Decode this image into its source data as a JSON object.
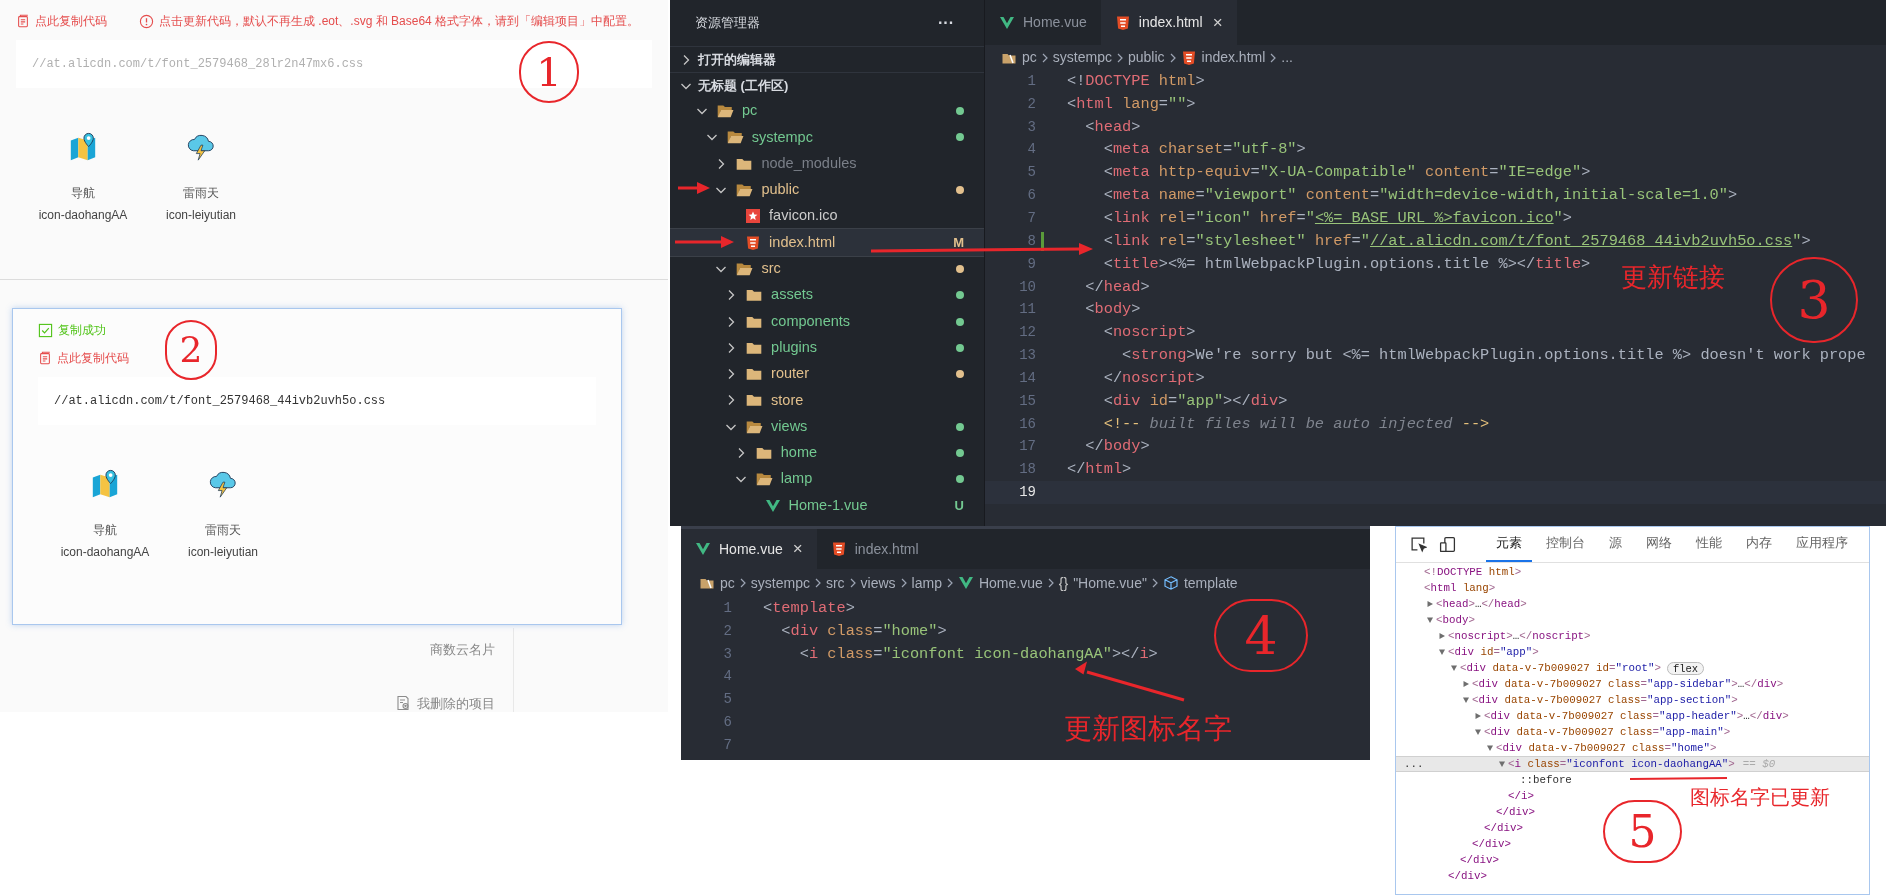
{
  "upload_panel": {
    "copy_link": "点此复制代码",
    "notice": "点击更新代码，默认不再生成 .eot、.svg 和 Base64 格式字体，请到「编辑项目」中配置。",
    "code": "//at.alicdn.com/t/font_2579468_28lr2n47mx6.css",
    "code_faded": true,
    "icons": [
      {
        "kind": "map",
        "label": "导航",
        "name": "icon-daohangAA"
      },
      {
        "kind": "storm",
        "label": "雷雨天",
        "name": "icon-leiyutian"
      }
    ],
    "annotation": "1"
  },
  "background_page": {
    "items": [
      {
        "kind": "text",
        "label": "商数云名片"
      },
      {
        "kind": "trash",
        "label": "我删除的项目"
      }
    ]
  },
  "copied_panel": {
    "success": "复制成功",
    "copy_link": "点此复制代码",
    "code": "//at.alicdn.com/t/font_2579468_44ivb2uvh5o.css",
    "code_faded": false,
    "icons": [
      {
        "kind": "map",
        "label": "导航",
        "name": "icon-daohangAA"
      },
      {
        "kind": "storm",
        "label": "雷雨天",
        "name": "icon-leiyutian"
      }
    ],
    "annotation": "2"
  },
  "code_editor": {
    "explorer": {
      "title": "资源管理器",
      "more": "···",
      "sections": [
        {
          "label": "打开的编辑器",
          "expanded": false
        },
        {
          "label": "无标题 (工作区)",
          "expanded": true,
          "children": [
            {
              "label": "pc",
              "kind": "folder",
              "expanded": true,
              "color": "#73c991",
              "dot": true,
              "selected": false,
              "children": [
                {
                  "label": "systempc",
                  "kind": "folder",
                  "expanded": true,
                  "color": "#73c991",
                  "dot": true,
                  "selected": false,
                  "children": [
                    {
                      "label": "node_modules",
                      "kind": "folder",
                      "expanded": false,
                      "color": "#7a7f88",
                      "dot": false,
                      "selected": false
                    },
                    {
                      "label": "public",
                      "kind": "folder",
                      "expanded": true,
                      "color": "#e2c08d",
                      "dot": true,
                      "selected": false,
                      "children": [
                        {
                          "label": "favicon.ico",
                          "kind": "favicon",
                          "color": "#cccccc",
                          "dot": false,
                          "selected": false
                        },
                        {
                          "label": "index.html",
                          "kind": "html",
                          "color": "#e2c08d",
                          "badge": "M",
                          "selected": true
                        }
                      ]
                    },
                    {
                      "label": "src",
                      "kind": "folder",
                      "expanded": true,
                      "color": "#e2c08d",
                      "dot": true,
                      "selected": false,
                      "children": [
                        {
                          "label": "assets",
                          "kind": "folder",
                          "expanded": false,
                          "color": "#73c991",
                          "dot": true,
                          "selected": false
                        },
                        {
                          "label": "components",
                          "kind": "folder",
                          "expanded": false,
                          "color": "#73c991",
                          "dot": true,
                          "selected": false
                        },
                        {
                          "label": "plugins",
                          "kind": "folder",
                          "expanded": false,
                          "color": "#73c991",
                          "dot": true,
                          "selected": false
                        },
                        {
                          "label": "router",
                          "kind": "folder",
                          "expanded": false,
                          "color": "#e2c08d",
                          "dot": true,
                          "selected": false
                        },
                        {
                          "label": "store",
                          "kind": "folder",
                          "expanded": false,
                          "color": "#e2c08d",
                          "dot": false,
                          "selected": false
                        },
                        {
                          "label": "views",
                          "kind": "folder",
                          "expanded": true,
                          "color": "#73c991",
                          "dot": true,
                          "selected": false,
                          "children": [
                            {
                              "label": "home",
                              "kind": "folder",
                              "expanded": false,
                              "color": "#73c991",
                              "dot": true,
                              "selected": false
                            },
                            {
                              "label": "lamp",
                              "kind": "folder",
                              "expanded": true,
                              "color": "#73c991",
                              "dot": true,
                              "selected": false,
                              "children": [
                                {
                                  "label": "Home-1.vue",
                                  "kind": "vue",
                                  "color": "#73c991",
                                  "badge": "U",
                                  "selected": false
                                }
                              ]
                            }
                          ]
                        }
                      ]
                    }
                  ]
                }
              ]
            }
          ]
        }
      ]
    },
    "tabs": [
      {
        "label": "Home.vue",
        "kind": "vue",
        "selected": false
      },
      {
        "label": "index.html",
        "kind": "html",
        "selected": true,
        "close": "×"
      }
    ],
    "breadcrumb": [
      {
        "label": "pc",
        "kind": "folder"
      },
      {
        "label": "systempc",
        "kind": "text"
      },
      {
        "label": "public",
        "kind": "text"
      },
      {
        "label": "index.html",
        "kind": "html"
      },
      {
        "label": "...",
        "kind": "text"
      }
    ],
    "lines": [
      {
        "n": "1",
        "text": "<!DOCTYPE html>",
        "changed": false,
        "current": false
      },
      {
        "n": "2",
        "text": "<html lang=\"\">",
        "changed": false,
        "current": false
      },
      {
        "n": "3",
        "text": "  <head>",
        "changed": false,
        "current": false
      },
      {
        "n": "4",
        "text": "    <meta charset=\"utf-8\">",
        "changed": false,
        "current": false
      },
      {
        "n": "5",
        "text": "    <meta http-equiv=\"X-UA-Compatible\" content=\"IE=edge\">",
        "changed": false,
        "current": false
      },
      {
        "n": "6",
        "text": "    <meta name=\"viewport\" content=\"width=device-width,initial-scale=1.0\">",
        "changed": false,
        "current": false
      },
      {
        "n": "7",
        "text": "    <link rel=\"icon\" href=\"<%= BASE_URL %>favicon.ico\">",
        "changed": false,
        "link": true,
        "current": false
      },
      {
        "n": "8",
        "text": "    <link rel=\"stylesheet\" href=\"//at.alicdn.com/t/font_2579468_44ivb2uvh5o.css\">",
        "changed": true,
        "link": true,
        "current": false
      },
      {
        "n": "9",
        "text": "    <title><%= htmlWebpackPlugin.options.title %></title>",
        "changed": false,
        "current": false
      },
      {
        "n": "10",
        "text": "  </head>",
        "changed": false,
        "current": false
      },
      {
        "n": "11",
        "text": "  <body>",
        "changed": false,
        "current": false
      },
      {
        "n": "12",
        "text": "    <noscript>",
        "changed": false,
        "current": false
      },
      {
        "n": "13",
        "text": "      <strong>We're sorry but <%= htmlWebpackPlugin.options.title %> doesn't work prope",
        "changed": false,
        "current": false
      },
      {
        "n": "14",
        "text": "    </noscript>",
        "changed": false,
        "current": false
      },
      {
        "n": "15",
        "text": "    <div id=\"app\"></div>",
        "changed": false,
        "current": false
      },
      {
        "n": "16",
        "text": "    <!-- built files will be auto injected -->",
        "changed": false,
        "current": false
      },
      {
        "n": "17",
        "text": "  </body>",
        "changed": false,
        "current": false
      },
      {
        "n": "18",
        "text": "</html>",
        "changed": false,
        "current": false
      },
      {
        "n": "19",
        "changed": false,
        "current": true
      }
    ],
    "note": "更新链接",
    "annotation": "3"
  },
  "template_editor": {
    "tabs": [
      {
        "label": "Home.vue",
        "kind": "vue",
        "selected": true,
        "close": "×"
      },
      {
        "label": "index.html",
        "kind": "html",
        "selected": false
      }
    ],
    "breadcrumb": [
      {
        "label": "pc",
        "kind": "folder"
      },
      {
        "label": "systempc",
        "kind": "text"
      },
      {
        "label": "src",
        "kind": "text"
      },
      {
        "label": "views",
        "kind": "text"
      },
      {
        "label": "lamp",
        "kind": "text"
      },
      {
        "label": "Home.vue",
        "kind": "vue"
      },
      {
        "label": "\"Home.vue\"",
        "kind": "object",
        "glyph": "{}"
      },
      {
        "label": "template",
        "kind": "element"
      }
    ],
    "lines": [
      {
        "n": "1",
        "text": "<template>"
      },
      {
        "n": "2",
        "text": "  <div class=\"home\">"
      },
      {
        "n": "3",
        "text": "    <i class=\"iconfont icon-daohangAA\"></i>"
      },
      {
        "n": "4"
      },
      {
        "n": "5"
      },
      {
        "n": "6"
      },
      {
        "n": "7"
      }
    ],
    "note": "更新图标名字",
    "annotation": "4"
  },
  "devtools": {
    "tabs": [
      {
        "label": "元素",
        "selected": true
      },
      {
        "label": "控制台",
        "selected": false
      },
      {
        "label": "源",
        "selected": false
      },
      {
        "label": "网络",
        "selected": false
      },
      {
        "label": "性能",
        "selected": false
      },
      {
        "label": "内存",
        "selected": false
      },
      {
        "label": "应用程序",
        "selected": false
      }
    ],
    "nodes": [
      {
        "text": "<!DOCTYPE html>",
        "selected": false
      },
      {
        "text": "<html lang>",
        "selected": false,
        "children": [
          {
            "text": "<head>…</head>",
            "expanded": false,
            "selected": false
          },
          {
            "text": "<body>",
            "expanded": true,
            "selected": false,
            "children": [
              {
                "text": "<noscript>…</noscript>",
                "expanded": false,
                "selected": false
              },
              {
                "text": "<div id=\"app\">",
                "expanded": true,
                "selected": false,
                "close": "</div>",
                "children": [
                  {
                    "text": "<div data-v-7b009027 id=\"root\">",
                    "badge": "flex",
                    "expanded": true,
                    "selected": false,
                    "close": "</div>",
                    "children": [
                      {
                        "text": "<div data-v-7b009027 class=\"app-sidebar\">…</div>",
                        "expanded": false,
                        "selected": false
                      },
                      {
                        "text": "<div data-v-7b009027 class=\"app-section\">",
                        "expanded": true,
                        "selected": false,
                        "close": "</div>",
                        "children": [
                          {
                            "text": "<div data-v-7b009027 class=\"app-header\">…</div>",
                            "expanded": false,
                            "selected": false
                          },
                          {
                            "text": "<div data-v-7b009027 class=\"app-main\">",
                            "expanded": true,
                            "selected": false,
                            "close": "</div>",
                            "children": [
                              {
                                "text": "<div data-v-7b009027 class=\"home\">",
                                "expanded": true,
                                "selected": false,
                                "close": "</div>",
                                "children": [
                                  {
                                    "text": "<i class=\"iconfont icon-daohangAA\">",
                                    "expanded": true,
                                    "selected": true,
                                    "gutter": "...",
                                    "suffix": "== $0",
                                    "close": "</i>",
                                    "children": [
                                      {
                                        "text": "::before",
                                        "selected": false
                                      }
                                    ]
                                  }
                                ]
                              }
                            ]
                          }
                        ]
                      }
                    ]
                  }
                ]
              }
            ]
          }
        ]
      }
    ],
    "note": "图标名字已更新",
    "annotation": "5"
  }
}
